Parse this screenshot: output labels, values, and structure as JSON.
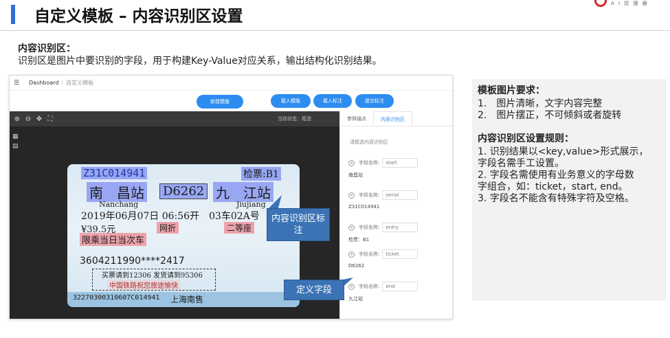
{
  "slide": {
    "title": "自定义模板 – 内容识别区设置",
    "logo_text": "A I 控 摆 器"
  },
  "intro": {
    "heading": "内容识别区：",
    "text": "识别区是图片中要识别的字段，用于构建Key-Value对应关系，输出结构化识别结果。"
  },
  "app": {
    "breadcrumb": {
      "home": "Dashboard",
      "sep": "/",
      "current": "自定义模板"
    },
    "buttons": {
      "new_template": "新建模版",
      "load_template": "载入模版",
      "load_mark": "载入标注",
      "submit_mark": "提交标注"
    },
    "status_label": "当前状态：框选",
    "tabs": [
      "参照锚点",
      "内容识别区"
    ],
    "region_hint": "请框选内容识别区",
    "field_label": "字段名称:",
    "fields": [
      {
        "name": "start",
        "value": "南昌站"
      },
      {
        "name": "serial",
        "value": "Z31C014941"
      },
      {
        "name": "entry",
        "value": "检票：B1"
      },
      {
        "name": "ticket",
        "value": "D6262"
      },
      {
        "name": "end",
        "value": "九江站"
      }
    ]
  },
  "ticket": {
    "serial": "Z31C014941",
    "check": "检票:B1",
    "from": "南　昌站",
    "train": "D6262",
    "to": "九　江站",
    "from_en": "Nanchang",
    "to_en": "Jiujiang",
    "date": "2019年06月07日 06:56开",
    "seat": "03车02A号",
    "price": "¥39.5元",
    "discount": "网折",
    "class": "二等座",
    "limit": "限乘当日当次车",
    "id": "3604211990****2417",
    "notice1": "买票请到12306 发货请到95306",
    "notice2": "中国铁路祝您旅途愉快",
    "code": "32270300310607C014941",
    "station": "上海南售"
  },
  "callouts": {
    "region": "内容识别区标注",
    "field": "定义字段"
  },
  "info": {
    "req_heading": "模板图片要求：",
    "req_items": [
      "1.　图片清晰，文字内容完整",
      "2.　图片摆正，不可倾斜或者旋转"
    ],
    "rule_heading": "内容识别区设置规则：",
    "rule_items": [
      "1. 识别结果以<key,value>形式展示，",
      "字段名需手工设置。",
      "2. 字段名需使用有业务意义的字母数",
      "字组合，如：ticket，start, end。",
      "3. 字段名不能含有特殊字符及空格。"
    ]
  },
  "colors": {
    "accent": "#2f6fd6",
    "button": "#2d8cf0",
    "callout": "#3b73b5"
  }
}
